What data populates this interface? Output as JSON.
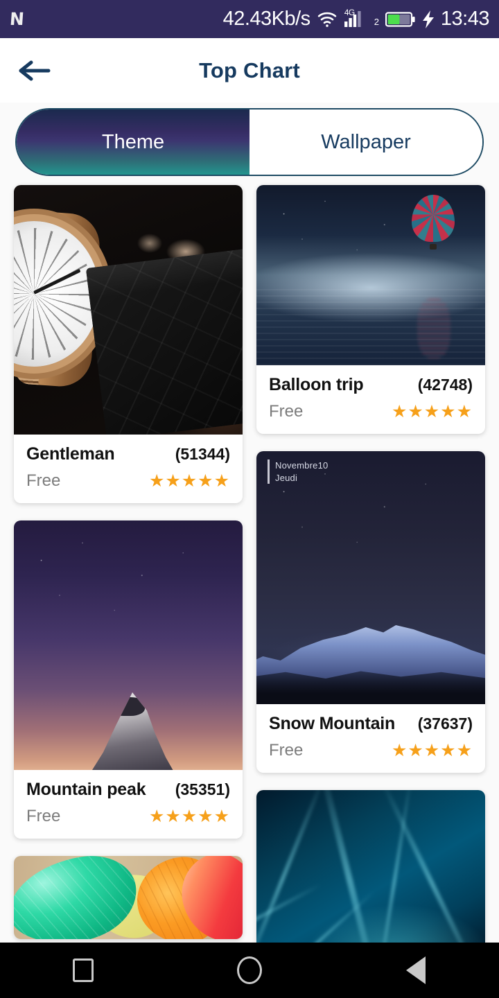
{
  "status_bar": {
    "carrier_logo": "N",
    "network_speed": "42.43Kb/s",
    "wifi_icon": "wifi-icon",
    "network_type": "4G",
    "sim_number": "2",
    "signal_icon": "signal-bars-icon",
    "battery_icon": "battery-icon",
    "charging_icon": "charging-bolt-icon",
    "time": "13:43",
    "background_color": "#322b5e"
  },
  "app_bar": {
    "back_icon": "back-arrow-icon",
    "title": "Top Chart",
    "title_color": "#163a5f"
  },
  "tabs": {
    "active_index": 0,
    "items": [
      {
        "label": "Theme",
        "active": true
      },
      {
        "label": "Wallpaper",
        "active": false
      }
    ],
    "active_gradient_from": "#1b2a4e",
    "active_gradient_to": "#23968f",
    "border_color": "#1d4a63"
  },
  "cards": [
    {
      "title": "Gentleman",
      "count": "(51344)",
      "price": "Free",
      "rating": "★★★★★",
      "rating_value": 5,
      "thumb": "watch-thumbnail",
      "column": "left"
    },
    {
      "title": "Balloon trip",
      "count": "(42748)",
      "price": "Free",
      "rating": "★★★★★",
      "rating_value": 5,
      "thumb": "balloon-thumbnail",
      "column": "right"
    },
    {
      "title": "Mountain peak",
      "count": "(35351)",
      "price": "Free",
      "rating": "★★★★★",
      "rating_value": 5,
      "thumb": "purple-mountain-thumbnail",
      "column": "left"
    },
    {
      "title": "Snow Mountain",
      "count": "(37637)",
      "price": "Free",
      "rating": "★★★★★",
      "rating_value": 5,
      "thumb": "snow-mountain-thumbnail",
      "overlay_line1": "Novembre10",
      "overlay_line2": "Jeudi",
      "column": "right"
    },
    {
      "title": "",
      "count": "",
      "price": "",
      "rating": "",
      "thumb": "colored-leaves-thumbnail",
      "column": "left",
      "partial": true
    },
    {
      "title": "",
      "count": "",
      "price": "",
      "rating": "",
      "thumb": "blue-abstract-thumbnail",
      "column": "right",
      "partial": true
    }
  ],
  "theme": {
    "star_color": "#f6a01a",
    "page_background": "#fafafa",
    "card_background": "#ffffff",
    "price_text_color": "#7c7c7c"
  },
  "nav_bar": {
    "recents_icon": "square-recents-icon",
    "home_icon": "circle-home-icon",
    "back_icon": "triangle-back-icon",
    "background_color": "#000000"
  }
}
